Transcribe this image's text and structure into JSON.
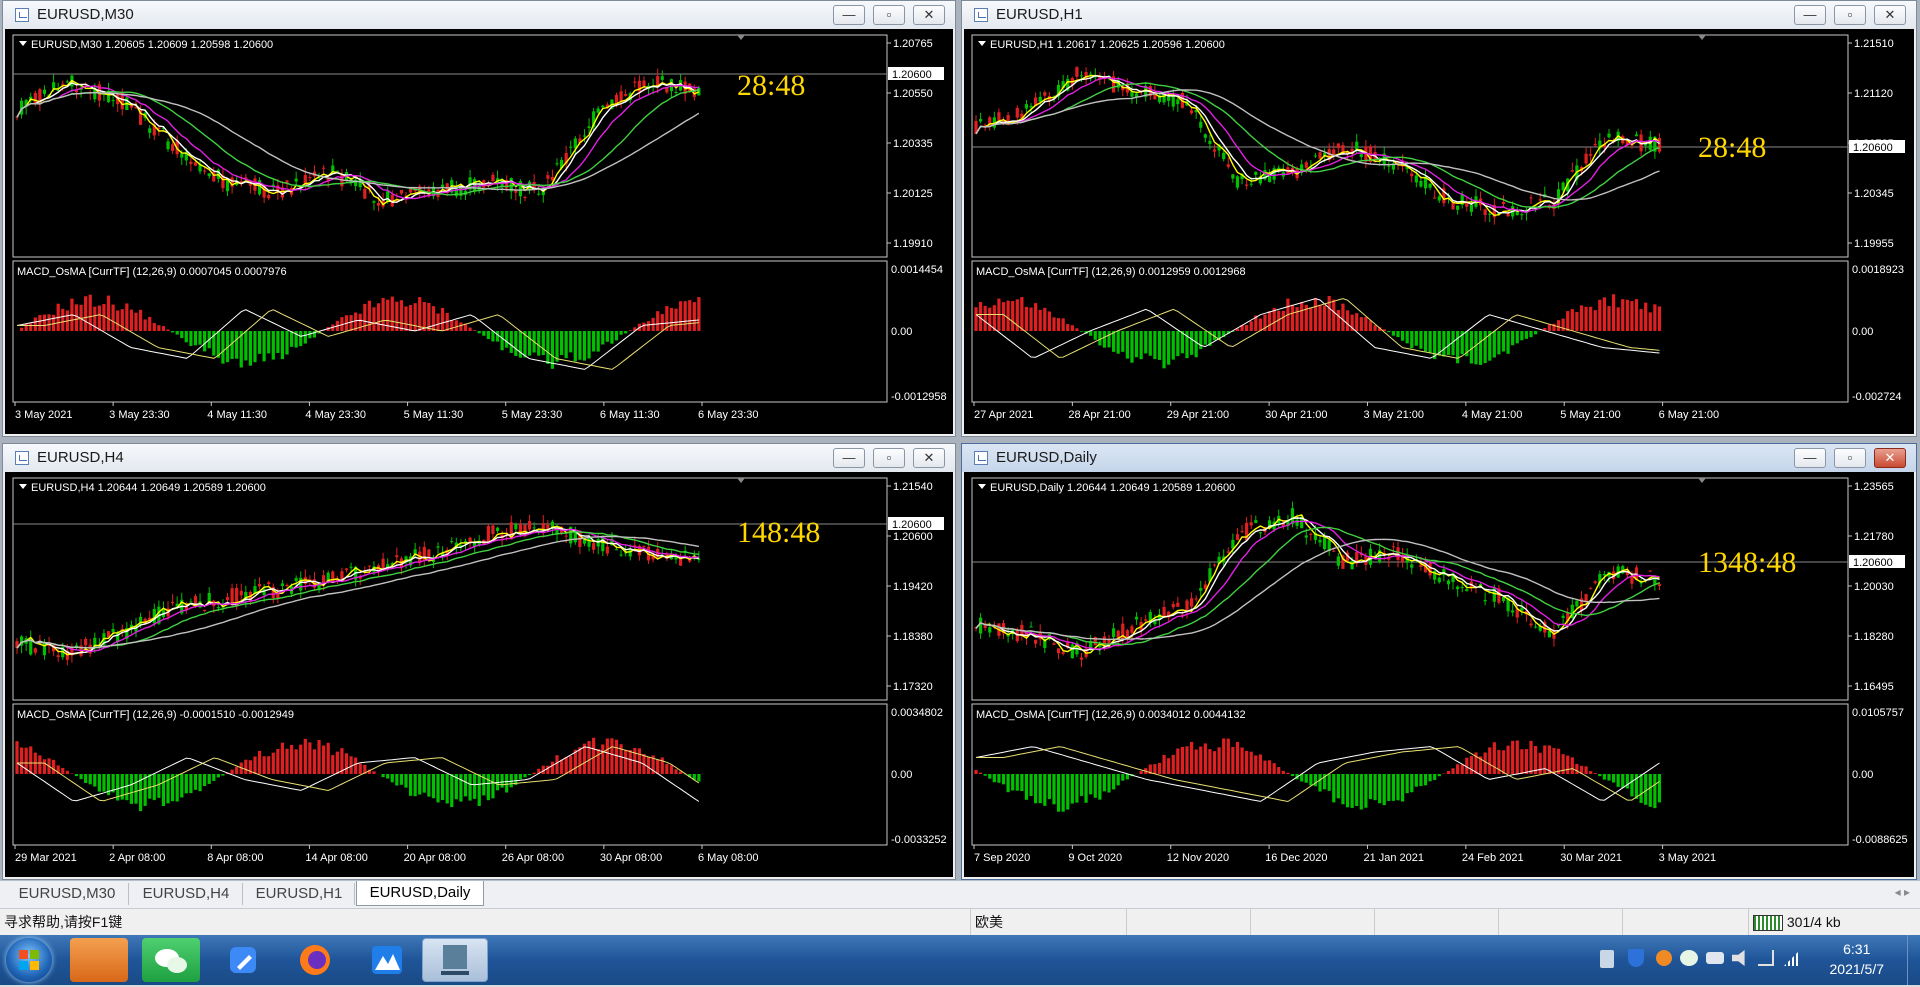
{
  "windows": [
    {
      "id": "m30",
      "title": "EURUSD,M30",
      "header": "EURUSD,M30  1.20605 1.20609 1.20598 1.20600",
      "price_labels": [
        "1.20765",
        "1.20550",
        "1.20335",
        "1.20125",
        "1.19910"
      ],
      "current_price": "1.20600",
      "countdown": "28:48",
      "macd_header": "MACD_OsMA [CurrTF] (12,26,9) 0.0007045 0.0007976",
      "macd_labels": [
        "0.0014454",
        "0.00",
        "-0.0012958"
      ],
      "time_labels": [
        "3 May 2021",
        "3 May 23:30",
        "4 May 11:30",
        "4 May 23:30",
        "5 May 11:30",
        "5 May 23:30",
        "6 May 11:30",
        "6 May 23:30"
      ],
      "active": false
    },
    {
      "id": "h1",
      "title": "EURUSD,H1",
      "header": "EURUSD,H1  1.20617 1.20625 1.20596 1.20600",
      "price_labels": [
        "1.21510",
        "1.21120",
        "1.20735",
        "1.20345",
        "1.19955"
      ],
      "current_price": "1.20600",
      "countdown": "28:48",
      "macd_header": "MACD_OsMA [CurrTF] (12,26,9) 0.0012959 0.0012968",
      "macd_labels": [
        "0.0018923",
        "0.00",
        "-0.002724"
      ],
      "time_labels": [
        "27 Apr 2021",
        "28 Apr 21:00",
        "29 Apr 21:00",
        "30 Apr 21:00",
        "3 May 21:00",
        "4 May 21:00",
        "5 May 21:00",
        "6 May 21:00"
      ],
      "active": false
    },
    {
      "id": "h4",
      "title": "EURUSD,H4",
      "header": "EURUSD,H4  1.20644 1.20649 1.20589 1.20600",
      "price_labels": [
        "1.21540",
        "1.20600",
        "1.19420",
        "1.18380",
        "1.17320"
      ],
      "current_price": "1.20600",
      "countdown": "148:48",
      "macd_header": "MACD_OsMA [CurrTF] (12,26,9) -0.0001510 -0.0012949",
      "macd_labels": [
        "0.0034802",
        "0.00",
        "-0.0033252"
      ],
      "time_labels": [
        "29 Mar 2021",
        "2 Apr 08:00",
        "8 Apr 08:00",
        "14 Apr 08:00",
        "20 Apr 08:00",
        "26 Apr 08:00",
        "30 Apr 08:00",
        "6 May 08:00"
      ],
      "active": false
    },
    {
      "id": "d1",
      "title": "EURUSD,Daily",
      "header": "EURUSD,Daily  1.20644 1.20649 1.20589 1.20600",
      "price_labels": [
        "1.23565",
        "1.21780",
        "1.20030",
        "1.18280",
        "1.16495"
      ],
      "current_price": "1.20600",
      "countdown": "1348:48",
      "macd_header": "MACD_OsMA [CurrTF] (12,26,9) 0.0034012 0.0044132",
      "macd_labels": [
        "0.0105757",
        "0.00",
        "-0.0088625"
      ],
      "time_labels": [
        "7 Sep 2020",
        "9 Oct 2020",
        "12 Nov 2020",
        "16 Dec 2020",
        "21 Jan 2021",
        "24 Feb 2021",
        "30 Mar 2021",
        "3 May 2021"
      ],
      "active": true
    }
  ],
  "tabs": [
    "EURUSD,M30",
    "EURUSD,H4",
    "EURUSD,H1",
    "EURUSD,Daily"
  ],
  "active_tab": 3,
  "status": {
    "help": "寻求帮助,请按F1键",
    "profile": "欧美",
    "traffic": "301/4 kb"
  },
  "clock": {
    "time": "6:31",
    "date": "2021/5/7"
  },
  "window_buttons": {
    "minimize": "—",
    "restore": "▫",
    "close": "✕"
  },
  "colors": {
    "bull": "#00c000",
    "bear": "#e02020",
    "ma_fast": "#ffff00",
    "ma_white": "#ffffff",
    "ma_magenta": "#e020e0",
    "ma_green": "#40d040",
    "ma_gray": "#c0c0c0",
    "countdown": "#ffd700"
  }
}
